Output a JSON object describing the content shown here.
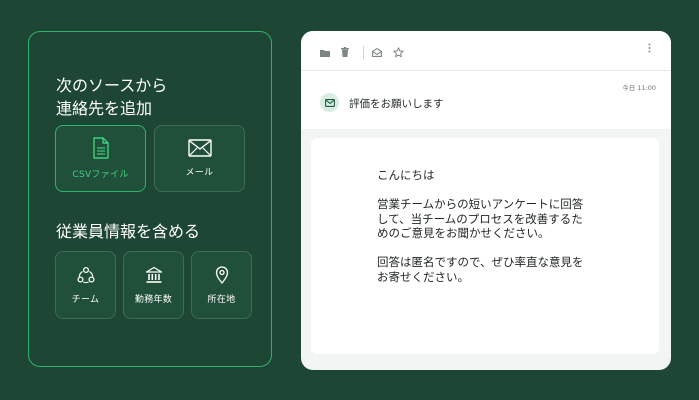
{
  "left_panel": {
    "title_line1": "次のソースから",
    "title_line2": "連絡先を追加",
    "sources": [
      {
        "label": "CSVファイル",
        "icon": "csv-file-icon",
        "selected": true
      },
      {
        "label": "メール",
        "icon": "mail-icon",
        "selected": false
      }
    ],
    "employee_title": "従業員情報を含める",
    "employee_options": [
      {
        "label": "チーム",
        "icon": "team-icon"
      },
      {
        "label": "勤務年数",
        "icon": "bank-icon"
      },
      {
        "label": "所在地",
        "icon": "location-pin-icon"
      }
    ]
  },
  "email": {
    "time": "今日 11:00",
    "subject": "評価をお願いします",
    "greeting": "こんにちは",
    "paragraph1": "営業チームからの短いアンケートに回答して、当チームのプロセスを改善するためのご意見をお聞かせください。",
    "paragraph2": "回答は匿名ですので、ぜひ率直な意見をお寄せください。"
  },
  "colors": {
    "background": "#1e4634",
    "accent": "#2fb36c"
  }
}
